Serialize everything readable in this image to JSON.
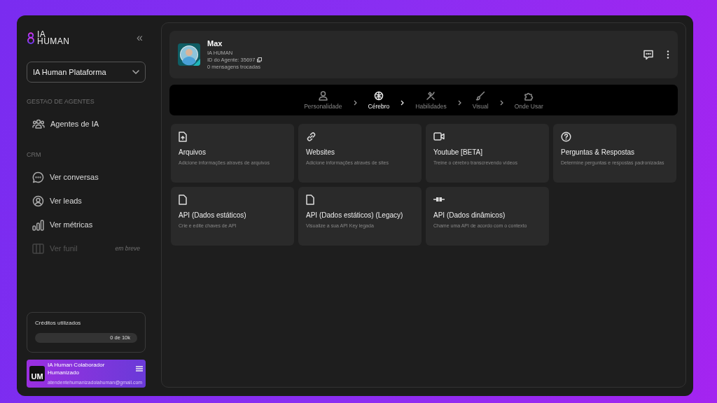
{
  "sidebar": {
    "logo": {
      "top": "IA",
      "bottom": "HUMAN"
    },
    "collapse_glyph": "«",
    "workspace": {
      "value": "IA Human Plataforma"
    },
    "sections": [
      {
        "title": "GESTAO DE AGENTES",
        "items": [
          {
            "label": "Agentes de IA",
            "disabled": false
          }
        ]
      },
      {
        "title": "CRM",
        "items": [
          {
            "label": "Ver conversas",
            "disabled": false
          },
          {
            "label": "Ver leads",
            "disabled": false
          },
          {
            "label": "Ver métricas",
            "disabled": false
          },
          {
            "label": "Ver funil",
            "disabled": true,
            "badge": "em breve"
          }
        ]
      }
    ],
    "credits": {
      "title": "Créditos utilizados",
      "level": 0,
      "reading": "0 de 10k"
    },
    "user": {
      "initials": "UM",
      "name": "IA Human Colaborador Humanizado",
      "email": "atendentehumanizadoiahuman@gmail.com"
    }
  },
  "agent": {
    "name": "Max",
    "company": "IA HUMAN",
    "id_label": "ID do Agente: 35697",
    "messages": "0 mensagens trocadas"
  },
  "steps": [
    {
      "label": "Personalidade",
      "selected": false
    },
    {
      "label": "Cérebro",
      "selected": true
    },
    {
      "label": "Habilidades",
      "selected": false
    },
    {
      "label": "Visual",
      "selected": false
    },
    {
      "label": "Onde Usar",
      "selected": false
    }
  ],
  "sources": [
    {
      "kind": "upload",
      "title": "Arquivos",
      "description": "Adicione informações através de arquivos"
    },
    {
      "kind": "link",
      "title": "Websites",
      "description": "Adicione informações através de sites"
    },
    {
      "kind": "video",
      "title": "Youtube [BETA]",
      "description": "Treine o cérebro transcrevendo vídeos"
    },
    {
      "kind": "question",
      "title": "Perguntas & Respostas",
      "description": "Determine perguntas e respostas padronizadas"
    },
    {
      "kind": "file",
      "title": "API (Dados estáticos)",
      "description": "Crie e edite chaves de API"
    },
    {
      "kind": "file",
      "title": "API (Dados estáticos) (Legacy)",
      "description": "Visualize a sua API Key legada"
    },
    {
      "kind": "plug",
      "title": "API (Dados dinâmicos)",
      "description": "Chame uma API de acordo com o contexto"
    }
  ]
}
